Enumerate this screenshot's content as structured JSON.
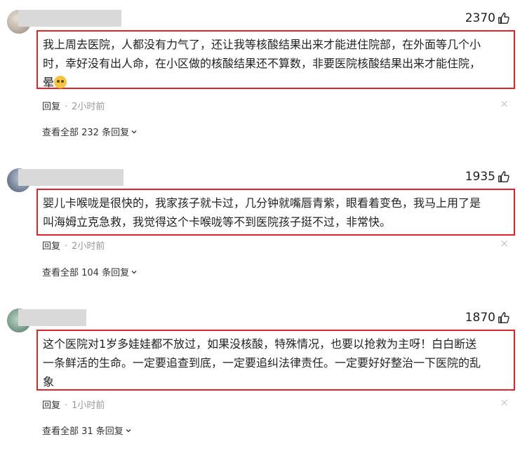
{
  "comments": [
    {
      "likes": "2370",
      "text_line1": "我上周去医院，人都没有力气了，还让我等核酸结果出来才能进住院部，在外面等几个小",
      "text_line2": "时，幸好没有出人命，在小区做的核酸结果还不算数，非要医院核酸结果出来才能住院，",
      "text_line3": "晕",
      "reply_label": "回复",
      "time": "2小时前",
      "view_replies": "查看全部 232 条回复"
    },
    {
      "likes": "1935",
      "text_line1": "婴儿卡喉咙是很快的，我家孩子就卡过，几分钟就嘴唇青紫，眼看着变色，我马上用了是",
      "text_line2": "叫海姆立克急救，我觉得这个卡喉咙等不到医院孩子挺不过，非常快。",
      "reply_label": "回复",
      "time": "2小时前",
      "view_replies": "查看全部 104 条回复"
    },
    {
      "likes": "1870",
      "text_line1": "这个医院对1岁多娃娃都不放过，如果没核酸，特殊情况，也要以抢救为主呀！白白断送",
      "text_line2": "一条鲜活的生命。一定要追查到底，一定要追纠法律责任。一定要好好整治一下医院的乱",
      "text_line3": "象",
      "reply_label": "回复",
      "time": "1小时前",
      "view_replies": "查看全部 31 条回复"
    }
  ],
  "icons": {
    "like": "thumb-up-icon",
    "close": "close-icon",
    "expand": "chevron-down-icon",
    "emoji": "dizzy-face-emoji-icon"
  },
  "colors": {
    "highlight_border": "#e0252a",
    "meta_gray": "#999999"
  },
  "close_glyph": "×"
}
